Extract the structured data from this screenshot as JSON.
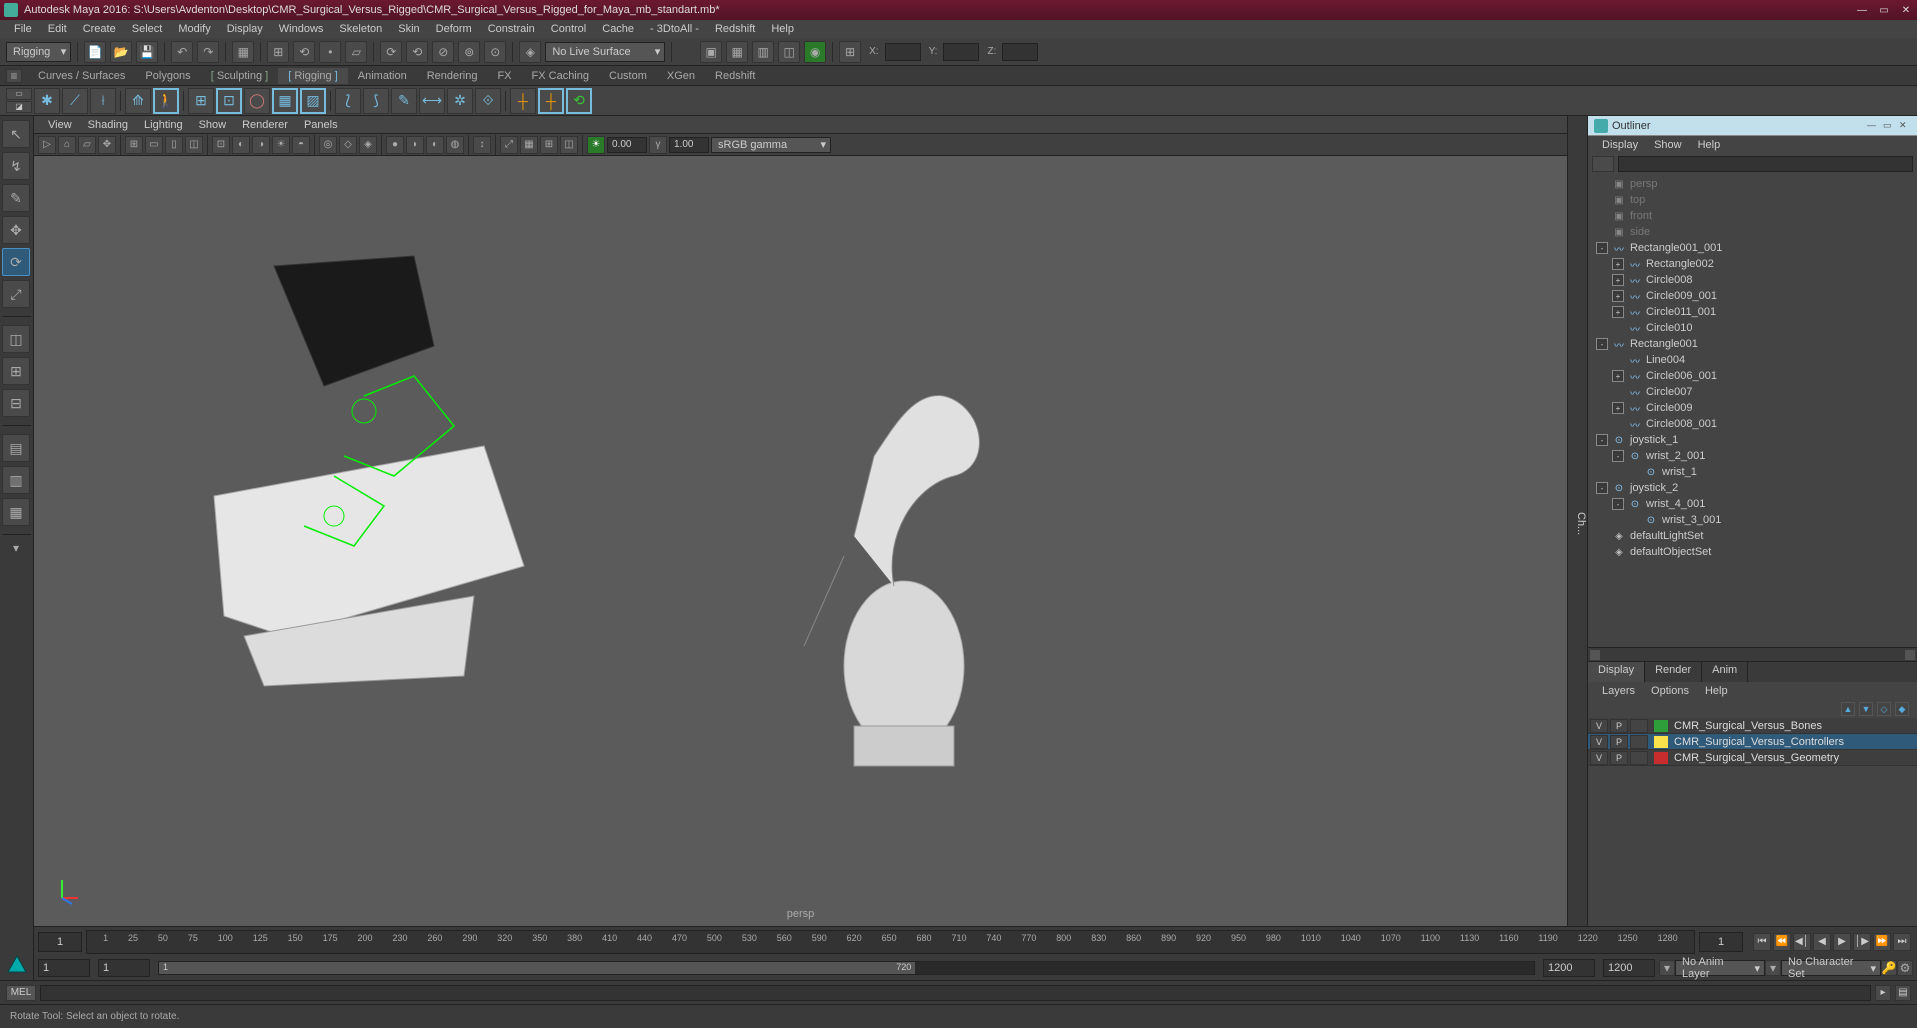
{
  "titlebar": {
    "title": "Autodesk Maya 2016: S:\\Users\\Avdenton\\Desktop\\CMR_Surgical_Versus_Rigged\\CMR_Surgical_Versus_Rigged_for_Maya_mb_standart.mb*"
  },
  "menubar": [
    "File",
    "Edit",
    "Create",
    "Select",
    "Modify",
    "Display",
    "Windows",
    "Skeleton",
    "Skin",
    "Deform",
    "Constrain",
    "Control",
    "Cache",
    "- 3DtoAll -",
    "Redshift",
    "Help"
  ],
  "toolbar": {
    "mode": "Rigging",
    "live_surface": "No Live Surface",
    "x_label": "X:",
    "y_label": "Y:",
    "z_label": "Z:"
  },
  "shelfs": [
    "Curves / Surfaces",
    "Polygons",
    "Sculpting",
    "Rigging",
    "Animation",
    "Rendering",
    "FX",
    "FX Caching",
    "Custom",
    "XGen",
    "Redshift"
  ],
  "active_shelf": "Rigging",
  "viewport_menu": [
    "View",
    "Shading",
    "Lighting",
    "Show",
    "Renderer",
    "Panels"
  ],
  "viewport": {
    "gamma_value": "1.00",
    "exposure_value": "0.00",
    "colorspace": "sRGB gamma",
    "camera_label": "persp"
  },
  "char_tab": "Ch...",
  "outliner": {
    "title": "Outliner",
    "menu": [
      "Display",
      "Show",
      "Help"
    ],
    "tree": [
      {
        "depth": 0,
        "expander": null,
        "icon": "cam",
        "label": "persp",
        "dim": true
      },
      {
        "depth": 0,
        "expander": null,
        "icon": "cam",
        "label": "top",
        "dim": true
      },
      {
        "depth": 0,
        "expander": null,
        "icon": "cam",
        "label": "front",
        "dim": true
      },
      {
        "depth": 0,
        "expander": null,
        "icon": "cam",
        "label": "side",
        "dim": true
      },
      {
        "depth": 0,
        "expander": "-",
        "icon": "curve",
        "label": "Rectangle001_001"
      },
      {
        "depth": 1,
        "expander": "+",
        "icon": "curve",
        "label": "Rectangle002"
      },
      {
        "depth": 1,
        "expander": "+",
        "icon": "curve",
        "label": "Circle008"
      },
      {
        "depth": 1,
        "expander": "+",
        "icon": "curve",
        "label": "Circle009_001"
      },
      {
        "depth": 1,
        "expander": "+",
        "icon": "curve",
        "label": "Circle011_001"
      },
      {
        "depth": 1,
        "expander": null,
        "icon": "curve",
        "label": "Circle010"
      },
      {
        "depth": 0,
        "expander": "-",
        "icon": "curve",
        "label": "Rectangle001"
      },
      {
        "depth": 1,
        "expander": null,
        "icon": "curve",
        "label": "Line004"
      },
      {
        "depth": 1,
        "expander": "+",
        "icon": "curve",
        "label": "Circle006_001"
      },
      {
        "depth": 1,
        "expander": null,
        "icon": "curve",
        "label": "Circle007"
      },
      {
        "depth": 1,
        "expander": "+",
        "icon": "curve",
        "label": "Circle009"
      },
      {
        "depth": 1,
        "expander": null,
        "icon": "curve",
        "label": "Circle008_001"
      },
      {
        "depth": 0,
        "expander": "-",
        "icon": "joint",
        "label": "joystick_1"
      },
      {
        "depth": 1,
        "expander": "-",
        "icon": "joint",
        "label": "wrist_2_001"
      },
      {
        "depth": 2,
        "expander": null,
        "icon": "joint",
        "label": "wrist_1"
      },
      {
        "depth": 0,
        "expander": "-",
        "icon": "joint",
        "label": "joystick_2"
      },
      {
        "depth": 1,
        "expander": "-",
        "icon": "joint",
        "label": "wrist_4_001"
      },
      {
        "depth": 2,
        "expander": null,
        "icon": "joint",
        "label": "wrist_3_001"
      },
      {
        "depth": 0,
        "expander": null,
        "icon": "set",
        "label": "defaultLightSet"
      },
      {
        "depth": 0,
        "expander": null,
        "icon": "set",
        "label": "defaultObjectSet"
      }
    ]
  },
  "layer_panel": {
    "tabs": [
      "Display",
      "Render",
      "Anim"
    ],
    "active_tab": "Display",
    "menu": [
      "Layers",
      "Options",
      "Help"
    ],
    "layers": [
      {
        "v": "V",
        "p": "P",
        "extra": "",
        "color": "#2e9e3a",
        "name": "CMR_Surgical_Versus_Bones",
        "selected": false
      },
      {
        "v": "V",
        "p": "P",
        "extra": "",
        "color": "#f9e24b",
        "name": "CMR_Surgical_Versus_Controllers",
        "selected": true
      },
      {
        "v": "V",
        "p": "P",
        "extra": "",
        "color": "#c72d2d",
        "name": "CMR_Surgical_Versus_Geometry",
        "selected": false
      }
    ]
  },
  "timeline": {
    "start": "1",
    "end": "",
    "current_frame_field": "1",
    "ticks": [
      "1",
      "25",
      "50",
      "75",
      "100",
      "125",
      "150",
      "175",
      "200",
      "230",
      "260",
      "290",
      "320",
      "350",
      "380",
      "410",
      "440",
      "470",
      "500",
      "530",
      "560",
      "590",
      "620",
      "650",
      "680",
      "710",
      "740",
      "770",
      "800",
      "830",
      "860",
      "890",
      "920",
      "950",
      "980",
      "1010",
      "1040",
      "1070",
      "1100",
      "1130",
      "1160",
      "1190",
      "1220",
      "1250",
      "1280"
    ]
  },
  "range": {
    "start": "1",
    "startB": "1",
    "midA": "720",
    "end": "1200",
    "endB": "1200",
    "anim_layer": "No Anim Layer",
    "char_set": "No Character Set"
  },
  "cmd": {
    "label": "MEL"
  },
  "status_text": "Rotate Tool: Select an object to rotate."
}
